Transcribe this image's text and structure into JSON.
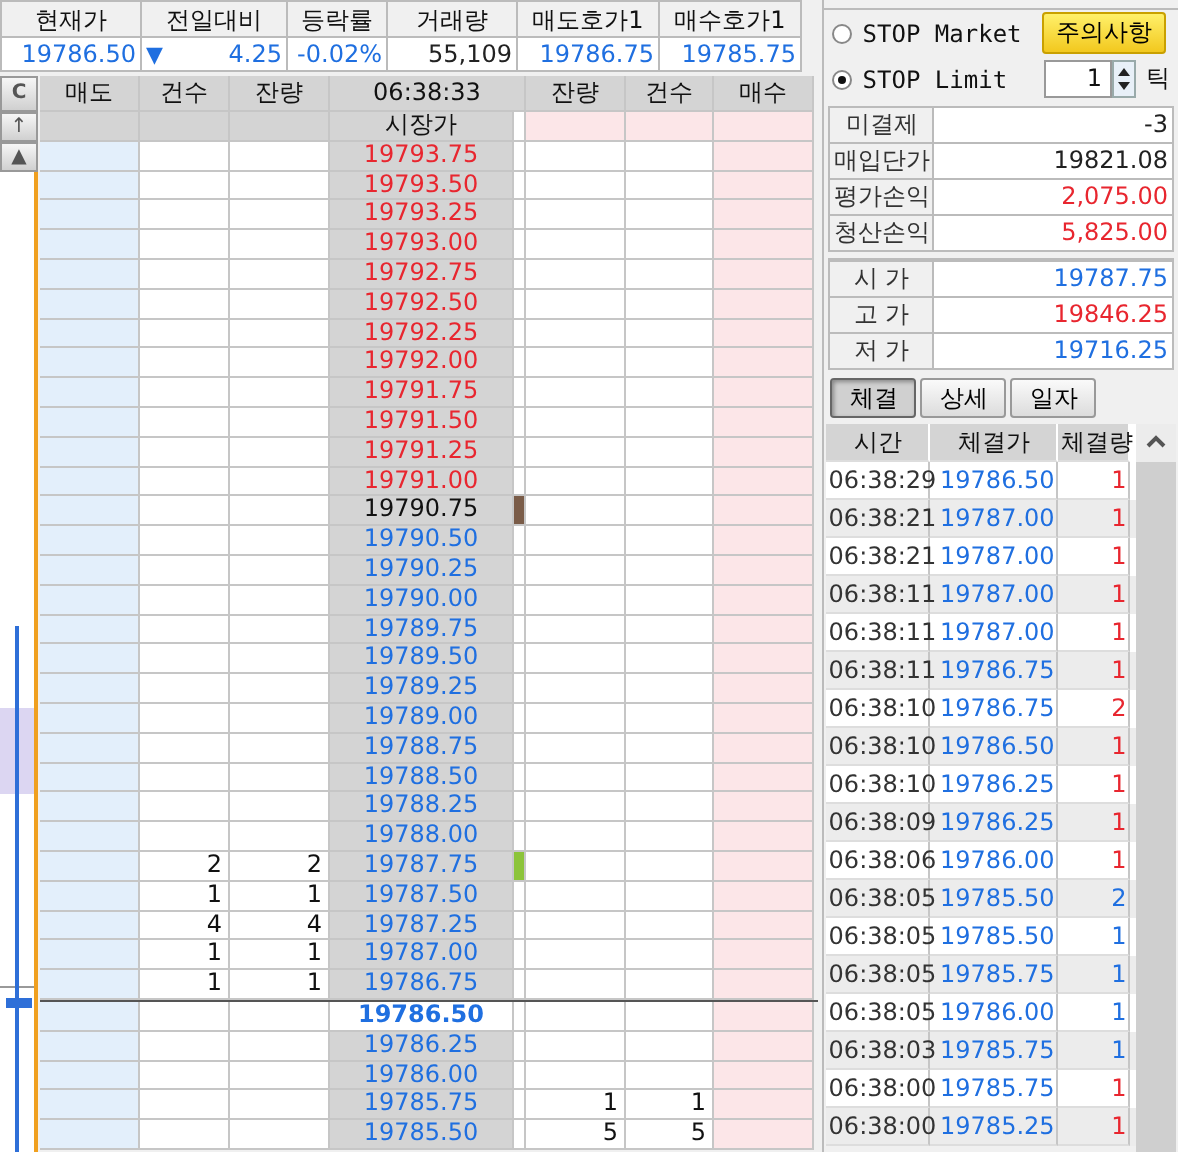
{
  "quote": {
    "columns": [
      {
        "label": "현재가",
        "value": "19786.50",
        "color": "#1f6fe0"
      },
      {
        "label": "전일대비",
        "arrow": "▼",
        "value": "4.25",
        "color": "#1f6fe0"
      },
      {
        "label": "등락률",
        "value": "-0.02%",
        "color": "#1f6fe0"
      },
      {
        "label": "거래량",
        "value": "55,109",
        "color": "#222222"
      },
      {
        "label": "매도호가1",
        "value": "19786.75",
        "color": "#1f6fe0"
      },
      {
        "label": "매수호가1",
        "value": "19785.75",
        "color": "#1f6fe0"
      }
    ]
  },
  "ladder": {
    "side_buttons": [
      "C",
      "↑",
      "▲"
    ],
    "columns": [
      "매도",
      "건수",
      "잔량",
      "06:38:33",
      "잔량",
      "건수",
      "매수"
    ],
    "market_row": "시장가",
    "rows": [
      {
        "price": "19793.75",
        "color": "#e8262f",
        "current": false
      },
      {
        "price": "19793.50",
        "color": "#e8262f",
        "current": false
      },
      {
        "price": "19793.25",
        "color": "#e8262f",
        "current": false
      },
      {
        "price": "19793.00",
        "color": "#e8262f",
        "current": false
      },
      {
        "price": "19792.75",
        "color": "#e8262f",
        "current": false
      },
      {
        "price": "19792.50",
        "color": "#e8262f",
        "current": false
      },
      {
        "price": "19792.25",
        "color": "#e8262f",
        "current": false
      },
      {
        "price": "19792.00",
        "color": "#e8262f",
        "current": false
      },
      {
        "price": "19791.75",
        "color": "#e8262f",
        "current": false
      },
      {
        "price": "19791.50",
        "color": "#e8262f",
        "current": false
      },
      {
        "price": "19791.25",
        "color": "#e8262f",
        "current": false
      },
      {
        "price": "19791.00",
        "color": "#e8262f",
        "current": false
      },
      {
        "price": "19790.75",
        "color": "#111111",
        "current": false,
        "marker": {
          "color": "#7a5c48"
        }
      },
      {
        "price": "19790.50",
        "color": "#1f6fe0",
        "current": false
      },
      {
        "price": "19790.25",
        "color": "#1f6fe0",
        "current": false
      },
      {
        "price": "19790.00",
        "color": "#1f6fe0",
        "current": false
      },
      {
        "price": "19789.75",
        "color": "#1f6fe0",
        "current": false
      },
      {
        "price": "19789.50",
        "color": "#1f6fe0",
        "current": false
      },
      {
        "price": "19789.25",
        "color": "#1f6fe0",
        "current": false
      },
      {
        "price": "19789.00",
        "color": "#1f6fe0",
        "current": false
      },
      {
        "price": "19788.75",
        "color": "#1f6fe0",
        "current": false
      },
      {
        "price": "19788.50",
        "color": "#1f6fe0",
        "current": false
      },
      {
        "price": "19788.25",
        "color": "#1f6fe0",
        "current": false
      },
      {
        "price": "19788.00",
        "color": "#1f6fe0",
        "current": false
      },
      {
        "price": "19787.75",
        "color": "#1f6fe0",
        "current": false,
        "marker": {
          "color": "#8cc43a"
        },
        "sell_count": "2",
        "sell_qty": "2"
      },
      {
        "price": "19787.50",
        "color": "#1f6fe0",
        "current": false,
        "sell_count": "1",
        "sell_qty": "1"
      },
      {
        "price": "19787.25",
        "color": "#1f6fe0",
        "current": false,
        "sell_count": "4",
        "sell_qty": "4"
      },
      {
        "price": "19787.00",
        "color": "#1f6fe0",
        "current": false,
        "sell_count": "1",
        "sell_qty": "1"
      },
      {
        "price": "19786.75",
        "color": "#1f6fe0",
        "current": false,
        "sell_count": "1",
        "sell_qty": "1"
      },
      {
        "price": "19786.50",
        "color": "#1f6fe0",
        "current": true
      },
      {
        "price": "19786.25",
        "color": "#1f6fe0",
        "current": false
      },
      {
        "price": "19786.00",
        "color": "#1f6fe0",
        "current": false
      },
      {
        "price": "19785.75",
        "color": "#1f6fe0",
        "current": false,
        "buy_qty": "1",
        "buy_count": "1"
      },
      {
        "price": "19785.50",
        "color": "#1f6fe0",
        "current": false,
        "buy_qty": "5",
        "buy_count": "5"
      }
    ]
  },
  "stop_orders": [
    {
      "label": "STOP Market",
      "selected": false
    },
    {
      "label": "STOP Limit",
      "selected": true
    }
  ],
  "notice_button": "주의사항",
  "tick_field": {
    "value": "1",
    "unit": "틱"
  },
  "position": [
    {
      "label": "미결제",
      "value": "-3",
      "color": "#222222"
    },
    {
      "label": "매입단가",
      "value": "19821.08",
      "color": "#222222"
    },
    {
      "label": "평가손익",
      "value": "2,075.00",
      "color": "#e8262f"
    },
    {
      "label": "청산손익",
      "value": "5,825.00",
      "color": "#e8262f"
    }
  ],
  "prices": [
    {
      "label": "시 가",
      "value": "19787.75",
      "color": "#1f6fe0"
    },
    {
      "label": "고 가",
      "value": "19846.25",
      "color": "#e8262f"
    },
    {
      "label": "저 가",
      "value": "19716.25",
      "color": "#1f6fe0"
    }
  ],
  "tabs": [
    {
      "label": "체결",
      "selected": true
    },
    {
      "label": "상세",
      "selected": false
    },
    {
      "label": "일자",
      "selected": false
    }
  ],
  "trades": {
    "columns": [
      "시간",
      "체결가",
      "체결량"
    ],
    "rows": [
      {
        "time": "06:38:29",
        "price": "19786.50",
        "qty": "1",
        "color": "#e8262f"
      },
      {
        "time": "06:38:21",
        "price": "19787.00",
        "qty": "1",
        "color": "#e8262f"
      },
      {
        "time": "06:38:21",
        "price": "19787.00",
        "qty": "1",
        "color": "#e8262f"
      },
      {
        "time": "06:38:11",
        "price": "19787.00",
        "qty": "1",
        "color": "#e8262f"
      },
      {
        "time": "06:38:11",
        "price": "19787.00",
        "qty": "1",
        "color": "#e8262f"
      },
      {
        "time": "06:38:11",
        "price": "19786.75",
        "qty": "1",
        "color": "#e8262f"
      },
      {
        "time": "06:38:10",
        "price": "19786.75",
        "qty": "2",
        "color": "#e8262f"
      },
      {
        "time": "06:38:10",
        "price": "19786.50",
        "qty": "1",
        "color": "#e8262f"
      },
      {
        "time": "06:38:10",
        "price": "19786.25",
        "qty": "1",
        "color": "#e8262f"
      },
      {
        "time": "06:38:09",
        "price": "19786.25",
        "qty": "1",
        "color": "#e8262f"
      },
      {
        "time": "06:38:06",
        "price": "19786.00",
        "qty": "1",
        "color": "#e8262f"
      },
      {
        "time": "06:38:05",
        "price": "19785.50",
        "qty": "2",
        "color": "#1f6fe0"
      },
      {
        "time": "06:38:05",
        "price": "19785.50",
        "qty": "1",
        "color": "#1f6fe0"
      },
      {
        "time": "06:38:05",
        "price": "19785.75",
        "qty": "1",
        "color": "#1f6fe0"
      },
      {
        "time": "06:38:05",
        "price": "19786.00",
        "qty": "1",
        "color": "#1f6fe0"
      },
      {
        "time": "06:38:03",
        "price": "19785.75",
        "qty": "1",
        "color": "#1f6fe0"
      },
      {
        "time": "06:38:00",
        "price": "19785.75",
        "qty": "1",
        "color": "#e8262f"
      },
      {
        "time": "06:38:00",
        "price": "19785.25",
        "qty": "1",
        "color": "#e8262f"
      }
    ]
  }
}
